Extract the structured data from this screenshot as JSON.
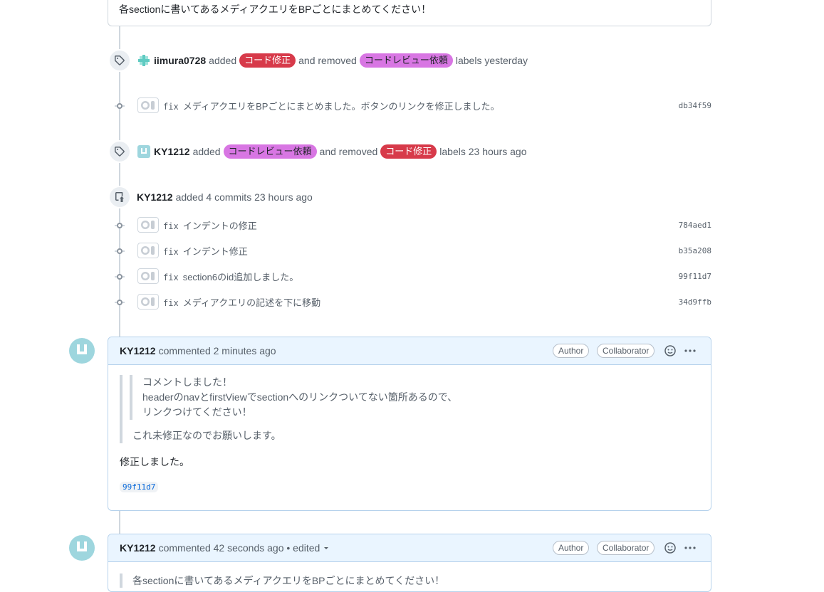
{
  "top_comment": {
    "text": "各sectionに書いてあるメディアクエリをBPごとにまとめてください！"
  },
  "label_event_1": {
    "actor": "iimura0728",
    "added_text": "added",
    "added_label": "コード修正",
    "removed_text": "and removed",
    "removed_label": "コードレビュー依頼",
    "suffix": "labels yesterday"
  },
  "commit_single": {
    "keyword": "fix",
    "message": "メディアクエリをBPごとにまとめました。ボタンのリンクを修正しました。",
    "sha": "db34f59"
  },
  "label_event_2": {
    "actor": "KY1212",
    "added_text": "added",
    "added_label": "コードレビュー依頼",
    "removed_text": "and removed",
    "removed_label": "コード修正",
    "suffix": "labels 23 hours ago"
  },
  "commits_event": {
    "actor": "KY1212",
    "text": "added 4 commits 23 hours ago"
  },
  "commits": [
    {
      "keyword": "fix",
      "message": "インデントの修正",
      "sha": "784aed1"
    },
    {
      "keyword": "fix",
      "message": "インデント修正",
      "sha": "b35a208"
    },
    {
      "keyword": "fix",
      "message": "section6のid追加しました。",
      "sha": "99f11d7"
    },
    {
      "keyword": "fix",
      "message": "メディアクエリの記述を下に移動",
      "sha": "34d9ffb"
    }
  ],
  "comment_1": {
    "actor": "KY1212",
    "meta": "commented 2 minutes ago",
    "role_author": "Author",
    "role_collab": "Collaborator",
    "quote_inner": [
      "コメントしました！",
      "headerのnavとfirstViewでsectionへのリンクついてない箇所あるので、",
      "リンクつけてください！"
    ],
    "quote_outer": "これ未修正なのでお願いします。",
    "body": "修正しました。",
    "sha_ref": "99f11d7"
  },
  "comment_2": {
    "actor": "KY1212",
    "meta": "commented 42 seconds ago • edited",
    "role_author": "Author",
    "role_collab": "Collaborator",
    "quote_partial": "各sectionに書いてあるメディアクエリをBPごとにまとめてください！"
  },
  "colors": {
    "label_red": "#d73a4a",
    "label_purple": "#d876e3",
    "comment_header": "#eaf5ff",
    "link": "#0969da"
  },
  "icons": [
    "tag-icon",
    "repo-push-icon",
    "git-commit-icon",
    "github-avatar-icon",
    "smiley-icon",
    "kebab-icon",
    "caret-down-icon"
  ]
}
